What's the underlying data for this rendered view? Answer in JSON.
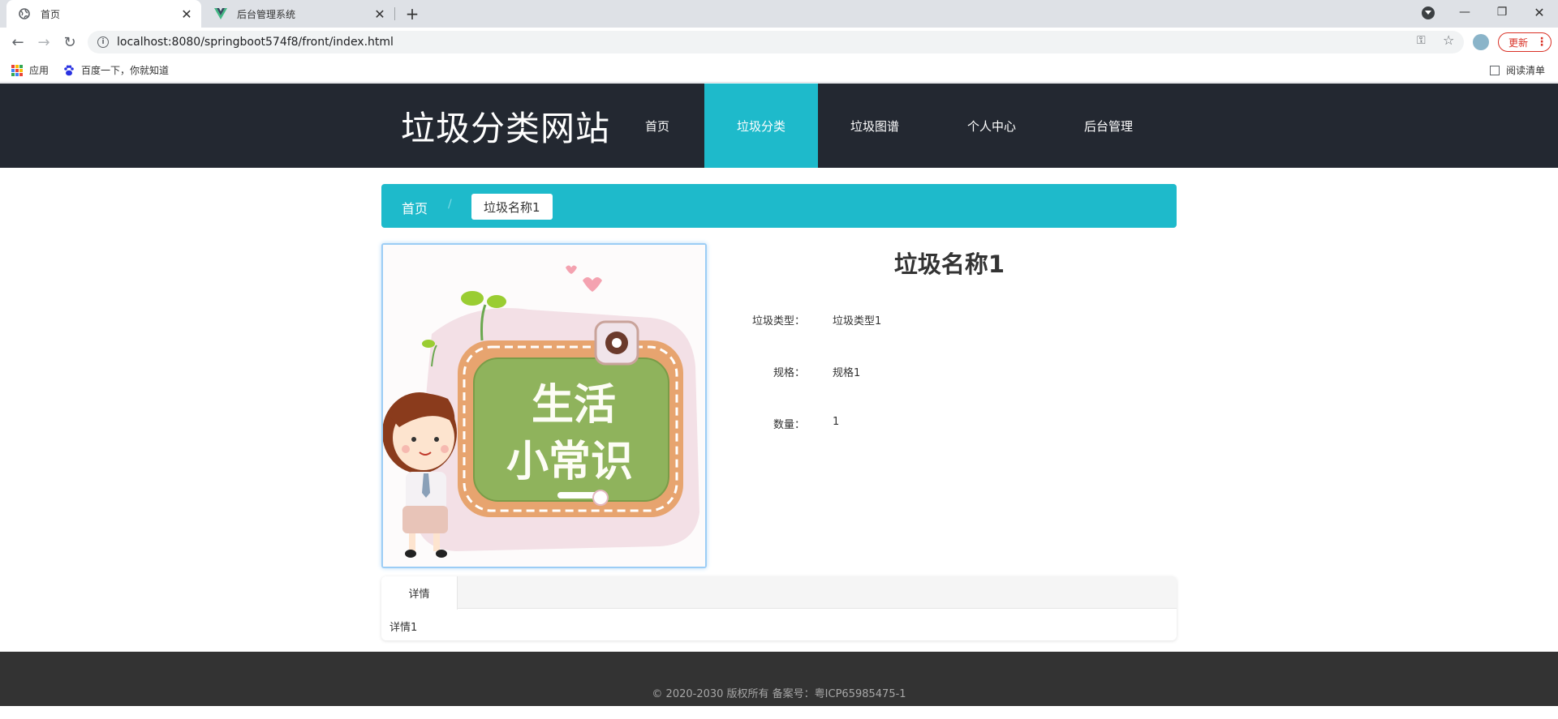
{
  "browser": {
    "tabs": [
      {
        "title": "首页",
        "active": true
      },
      {
        "title": "后台管理系统",
        "active": false
      }
    ],
    "url": "localhost:8080/springboot574f8/front/index.html",
    "update_label": "更新",
    "bookmarks": [
      {
        "label": "应用"
      },
      {
        "label": "百度一下，你就知道"
      }
    ],
    "reading_list": "阅读清单"
  },
  "site": {
    "title": "垃圾分类网站",
    "nav": [
      {
        "label": "首页",
        "active": false
      },
      {
        "label": "垃圾分类",
        "active": true
      },
      {
        "label": "垃圾图谱",
        "active": false
      },
      {
        "label": "个人中心",
        "active": false
      },
      {
        "label": "后台管理",
        "active": false
      }
    ]
  },
  "breadcrumb": {
    "home": "首页",
    "separator": "/",
    "current": "垃圾名称1"
  },
  "image": {
    "text_line1": "生活",
    "text_line2": "小常识"
  },
  "detail": {
    "title": "垃圾名称1",
    "fields": [
      {
        "label": "垃圾类型：",
        "value": "垃圾类型1"
      },
      {
        "label": "规格：",
        "value": "规格1"
      },
      {
        "label": "数量：",
        "value": "1"
      }
    ]
  },
  "tabs": {
    "active_label": "详情",
    "content": "详情1"
  },
  "footer": {
    "text": "© 2020-2030 版权所有 备案号：粤ICP65985475-1"
  },
  "colors": {
    "accent": "#1ebacb",
    "header_bg": "#232831",
    "footer_bg": "#333333"
  }
}
